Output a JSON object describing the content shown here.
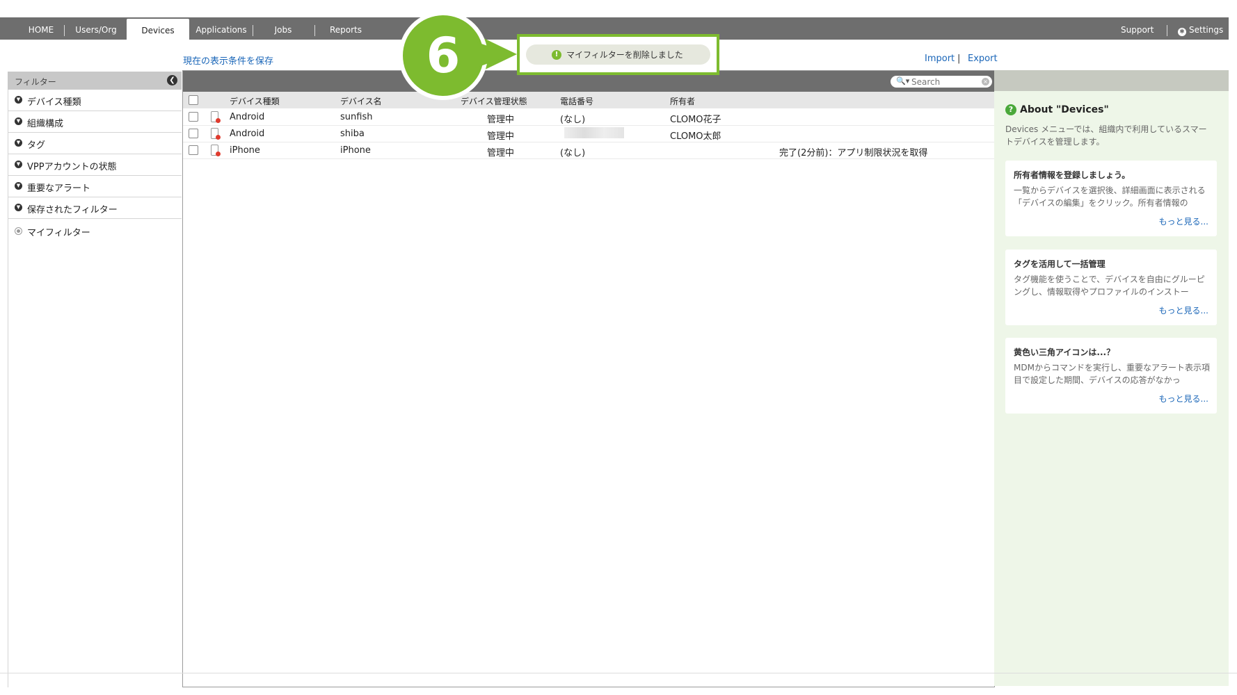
{
  "nav": {
    "tabs": [
      {
        "label": "HOME"
      },
      {
        "label": "Users/Org"
      },
      {
        "label": "Devices"
      },
      {
        "label": "Applications"
      },
      {
        "label": "Jobs"
      },
      {
        "label": "Reports"
      }
    ],
    "support": "Support",
    "settings": "Settings",
    "settings_icon": "gear-icon"
  },
  "save_view_link": "現在の表示条件を保存",
  "import_link": "Import",
  "link_separator": "|",
  "export_link": "Export",
  "sidebar": {
    "header": "フィルター",
    "items": [
      {
        "label": "デバイス種類"
      },
      {
        "label": "組織構成"
      },
      {
        "label": "タグ"
      },
      {
        "label": "VPPアカウントの状態"
      },
      {
        "label": "重要なアラート"
      },
      {
        "label": "保存されたフィルター"
      },
      {
        "label": "マイフィルター"
      }
    ]
  },
  "search": {
    "placeholder": "Search"
  },
  "table": {
    "columns": [
      "デバイス種類",
      "デバイス名",
      "デバイス管理状態",
      "電話番号",
      "所有者"
    ],
    "rows": [
      {
        "type": "Android",
        "name": "sunfish",
        "status": "管理中",
        "phone": "(なし)",
        "owner": "CLOMO花子",
        "note": ""
      },
      {
        "type": "Android",
        "name": "shiba",
        "status": "管理中",
        "phone": "",
        "owner": "CLOMO太郎",
        "note": ""
      },
      {
        "type": "iPhone",
        "name": "iPhone",
        "status": "管理中",
        "phone": "(なし)",
        "owner": "",
        "note": "完了(2分前)：アプリ制限状況を取得"
      }
    ]
  },
  "about": {
    "title": "About \"Devices\"",
    "text": "Devices メニューでは、組織内で利用しているスマートデバイスを管理します。",
    "cards": [
      {
        "title": "所有者情報を登録しましょう。",
        "text": "一覧からデバイスを選択後、詳細画面に表示される「デバイスの編集」をクリック。所有者情報の",
        "more": "もっと見る..."
      },
      {
        "title": "タグを活用して一括管理",
        "text": "タグ機能を使うことで、デバイスを自由にグルーピングし、情報取得やプロファイルのインストー",
        "more": "もっと見る..."
      },
      {
        "title": "黄色い三角アイコンは...？",
        "text": "MDMからコマンドを実行し、重要なアラート表示項目で設定した期間、デバイスの応答がなかっ",
        "more": "もっと見る..."
      }
    ]
  },
  "toast": {
    "text": "マイフィルターを削除しました"
  },
  "callout": {
    "number": "6"
  },
  "colors": {
    "nav": "#6e6e6e",
    "accent_green": "#7dbb2f",
    "link": "#1a66b8",
    "right_panel": "#eef6e8"
  }
}
